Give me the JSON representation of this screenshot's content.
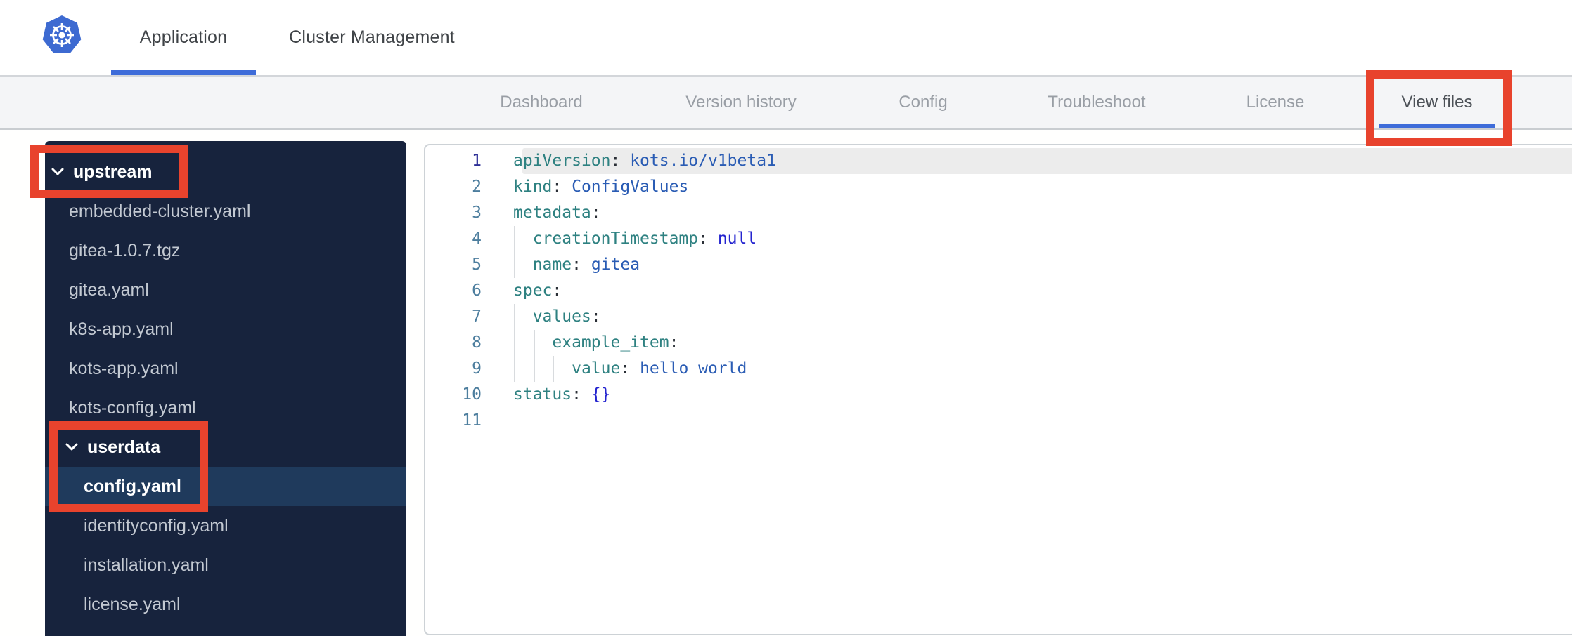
{
  "header": {
    "logo": "kubernetes-logo",
    "tabs": [
      {
        "label": "Application",
        "active": true
      },
      {
        "label": "Cluster Management",
        "active": false
      }
    ]
  },
  "nav": {
    "tabs": [
      {
        "label": "Dashboard",
        "active": false
      },
      {
        "label": "Version history",
        "active": false
      },
      {
        "label": "Config",
        "active": false
      },
      {
        "label": "Troubleshoot",
        "active": false
      },
      {
        "label": "License",
        "active": false
      },
      {
        "label": "View files",
        "active": true
      }
    ]
  },
  "file_tree": {
    "items": [
      {
        "label": "upstream",
        "type": "folder",
        "level": 0,
        "expanded": true
      },
      {
        "label": "embedded-cluster.yaml",
        "type": "file",
        "level": 1
      },
      {
        "label": "gitea-1.0.7.tgz",
        "type": "file",
        "level": 1
      },
      {
        "label": "gitea.yaml",
        "type": "file",
        "level": 1
      },
      {
        "label": "k8s-app.yaml",
        "type": "file",
        "level": 1
      },
      {
        "label": "kots-app.yaml",
        "type": "file",
        "level": 1
      },
      {
        "label": "kots-config.yaml",
        "type": "file",
        "level": 1
      },
      {
        "label": "userdata",
        "type": "folder",
        "level": 1,
        "expanded": true
      },
      {
        "label": "config.yaml",
        "type": "file",
        "level": 2,
        "selected": true
      },
      {
        "label": "identityconfig.yaml",
        "type": "file",
        "level": 2
      },
      {
        "label": "installation.yaml",
        "type": "file",
        "level": 2
      },
      {
        "label": "license.yaml",
        "type": "file",
        "level": 2
      }
    ]
  },
  "editor": {
    "language": "yaml",
    "lines": [
      {
        "n": 1,
        "active": true,
        "guides": 0,
        "tokens": [
          [
            "key",
            "apiVersion"
          ],
          [
            "punct",
            ":"
          ],
          [
            "plain",
            " "
          ],
          [
            "str",
            "kots.io/v1beta1"
          ]
        ]
      },
      {
        "n": 2,
        "guides": 0,
        "tokens": [
          [
            "key",
            "kind"
          ],
          [
            "punct",
            ":"
          ],
          [
            "plain",
            " "
          ],
          [
            "str",
            "ConfigValues"
          ]
        ]
      },
      {
        "n": 3,
        "guides": 0,
        "tokens": [
          [
            "key",
            "metadata"
          ],
          [
            "punct",
            ":"
          ]
        ]
      },
      {
        "n": 4,
        "guides": 1,
        "tokens": [
          [
            "plain",
            "  "
          ],
          [
            "key",
            "creationTimestamp"
          ],
          [
            "punct",
            ":"
          ],
          [
            "plain",
            " "
          ],
          [
            "atom",
            "null"
          ]
        ]
      },
      {
        "n": 5,
        "guides": 1,
        "tokens": [
          [
            "plain",
            "  "
          ],
          [
            "key",
            "name"
          ],
          [
            "punct",
            ":"
          ],
          [
            "plain",
            " "
          ],
          [
            "str",
            "gitea"
          ]
        ]
      },
      {
        "n": 6,
        "guides": 0,
        "tokens": [
          [
            "key",
            "spec"
          ],
          [
            "punct",
            ":"
          ]
        ]
      },
      {
        "n": 7,
        "guides": 1,
        "tokens": [
          [
            "plain",
            "  "
          ],
          [
            "key",
            "values"
          ],
          [
            "punct",
            ":"
          ]
        ]
      },
      {
        "n": 8,
        "guides": 2,
        "tokens": [
          [
            "plain",
            "    "
          ],
          [
            "key",
            "example_item"
          ],
          [
            "punct",
            ":"
          ]
        ]
      },
      {
        "n": 9,
        "guides": 3,
        "tokens": [
          [
            "plain",
            "      "
          ],
          [
            "key",
            "value"
          ],
          [
            "punct",
            ":"
          ],
          [
            "plain",
            " "
          ],
          [
            "str",
            "hello world"
          ]
        ]
      },
      {
        "n": 10,
        "guides": 0,
        "tokens": [
          [
            "key",
            "status"
          ],
          [
            "punct",
            ":"
          ],
          [
            "plain",
            " "
          ],
          [
            "atom",
            "{}"
          ]
        ]
      },
      {
        "n": 11,
        "guides": 0,
        "tokens": []
      }
    ]
  },
  "annotations": {
    "color": "#e8432d",
    "boxes": [
      "view-files-tab",
      "upstream-folder",
      "userdata-config-yaml"
    ]
  },
  "colors": {
    "accent_blue": "#3e6cd9",
    "sidebar_bg": "#17233d",
    "sidebar_selected_bg": "#1f3a5c",
    "nav_bg": "#f4f5f7",
    "annotation_red": "#e8432d",
    "syntax_key": "#2e8181",
    "syntax_string": "#2a5cb4",
    "syntax_atom": "#2424cf",
    "active_line_bg": "#ececec"
  }
}
